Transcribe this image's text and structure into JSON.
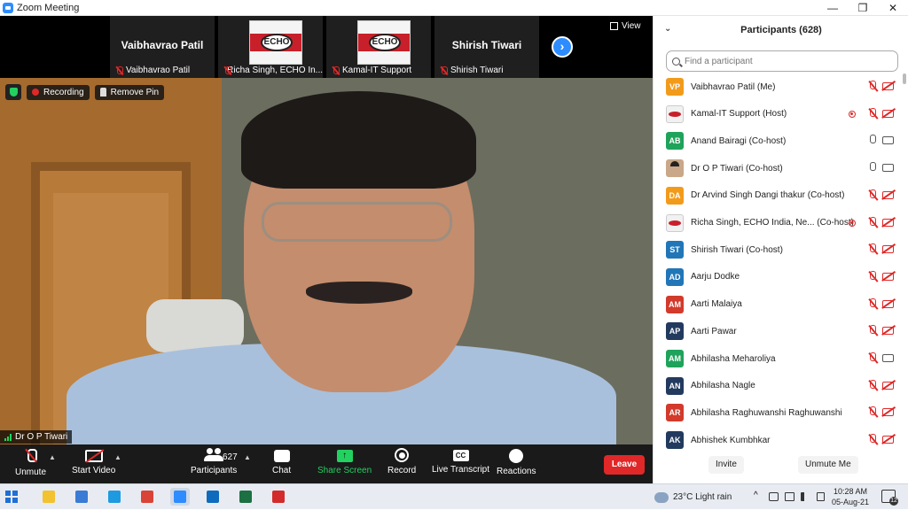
{
  "window": {
    "title": "Zoom Meeting",
    "controls": [
      "—",
      "❐",
      "✕"
    ]
  },
  "filmstrip": {
    "tiles": [
      {
        "big_name": "Vaibhavrao Patil",
        "label": "Vaibhavrao Patil",
        "kind": "name"
      },
      {
        "big_name": "",
        "label": "Richa Singh, ECHO In...",
        "kind": "echo"
      },
      {
        "big_name": "",
        "label": "Kamal-IT Support",
        "kind": "echo"
      },
      {
        "big_name": "Shirish Tiwari",
        "label": "Shirish Tiwari",
        "kind": "name"
      }
    ],
    "echo_text": "ECHO",
    "next_icon": "chevron-right-icon",
    "view_label": "View"
  },
  "main_video": {
    "recording_label": "Recording",
    "remove_pin_label": "Remove Pin",
    "speaker_name": "Dr O P Tiwari"
  },
  "toolbar": {
    "unmute": "Unmute",
    "start_video": "Start Video",
    "participants": "Participants",
    "participant_count": "627",
    "chat": "Chat",
    "share_screen": "Share Screen",
    "record": "Record",
    "live_transcript": "Live Transcript",
    "reactions": "Reactions",
    "leave": "Leave",
    "cc_text": "CC",
    "share_glyph": "↑"
  },
  "panel": {
    "title": "Participants (628)",
    "search_placeholder": "Find a participant",
    "participants": [
      {
        "initials": "VP",
        "color": "#f29b1b",
        "name": "Vaibhavrao Patil (Me)",
        "avatar": "initials",
        "rec": false,
        "mic": "off",
        "cam": "off"
      },
      {
        "initials": "",
        "color": "",
        "name": "Kamal-IT Support (Host)",
        "avatar": "echo",
        "rec": true,
        "mic": "off",
        "cam": "off"
      },
      {
        "initials": "AB",
        "color": "#1fa35b",
        "name": "Anand Bairagi (Co-host)",
        "avatar": "initials",
        "rec": false,
        "mic": "on",
        "cam": "on"
      },
      {
        "initials": "",
        "color": "",
        "name": "Dr O P Tiwari (Co-host)",
        "avatar": "face",
        "rec": false,
        "mic": "on",
        "cam": "on"
      },
      {
        "initials": "DA",
        "color": "#f29b1b",
        "name": "Dr Arvind Singh Dangi thakur (Co-host)",
        "avatar": "initials",
        "rec": false,
        "mic": "off",
        "cam": "off"
      },
      {
        "initials": "",
        "color": "",
        "name": "Richa Singh, ECHO India, Ne...  (Co-host)",
        "avatar": "echo",
        "rec": true,
        "mic": "off",
        "cam": "off"
      },
      {
        "initials": "ST",
        "color": "#2176b8",
        "name": "Shirish Tiwari (Co-host)",
        "avatar": "initials",
        "rec": false,
        "mic": "off",
        "cam": "off"
      },
      {
        "initials": "AD",
        "color": "#2176b8",
        "name": "Aarju Dodke",
        "avatar": "initials",
        "rec": false,
        "mic": "off",
        "cam": "off"
      },
      {
        "initials": "AM",
        "color": "#d23a2b",
        "name": "Aarti Malaiya",
        "avatar": "initials",
        "rec": false,
        "mic": "off",
        "cam": "off"
      },
      {
        "initials": "AP",
        "color": "#223a5e",
        "name": "Aarti Pawar",
        "avatar": "initials",
        "rec": false,
        "mic": "off",
        "cam": "off"
      },
      {
        "initials": "AM",
        "color": "#1fa35b",
        "name": "Abhilasha Meharoliya",
        "avatar": "initials",
        "rec": false,
        "mic": "off",
        "cam": "on-red"
      },
      {
        "initials": "AN",
        "color": "#223a5e",
        "name": "Abhilasha Nagle",
        "avatar": "initials",
        "rec": false,
        "mic": "off",
        "cam": "off"
      },
      {
        "initials": "AR",
        "color": "#d23a2b",
        "name": "Abhilasha Raghuwanshi Raghuwanshi",
        "avatar": "initials",
        "rec": false,
        "mic": "off",
        "cam": "off"
      },
      {
        "initials": "AK",
        "color": "#223a5e",
        "name": "Abhishek Kumbhkar",
        "avatar": "initials",
        "rec": false,
        "mic": "off",
        "cam": "off"
      }
    ],
    "invite": "Invite",
    "mute_me": "Unmute Me"
  },
  "taskbar": {
    "apps": [
      {
        "name": "file-explorer-icon",
        "color": "#f2c230"
      },
      {
        "name": "store-icon",
        "color": "#3a7bd5"
      },
      {
        "name": "edge-icon",
        "color": "#1e9be0"
      },
      {
        "name": "chrome-icon",
        "color": "#d94436"
      },
      {
        "name": "zoom-icon",
        "color": "#2d8cff",
        "active": true
      },
      {
        "name": "outlook-icon",
        "color": "#0f6cbd"
      },
      {
        "name": "excel-icon",
        "color": "#1d7044"
      },
      {
        "name": "acrobat-icon",
        "color": "#d32b2b"
      }
    ],
    "weather": "23°C  Light rain",
    "time": "10:28 AM",
    "date": "05-Aug-21",
    "notifications": "12",
    "tray_caret": "^"
  },
  "colors": {
    "accent": "#2d8cff",
    "leave": "#e02828",
    "share": "#23d160"
  }
}
